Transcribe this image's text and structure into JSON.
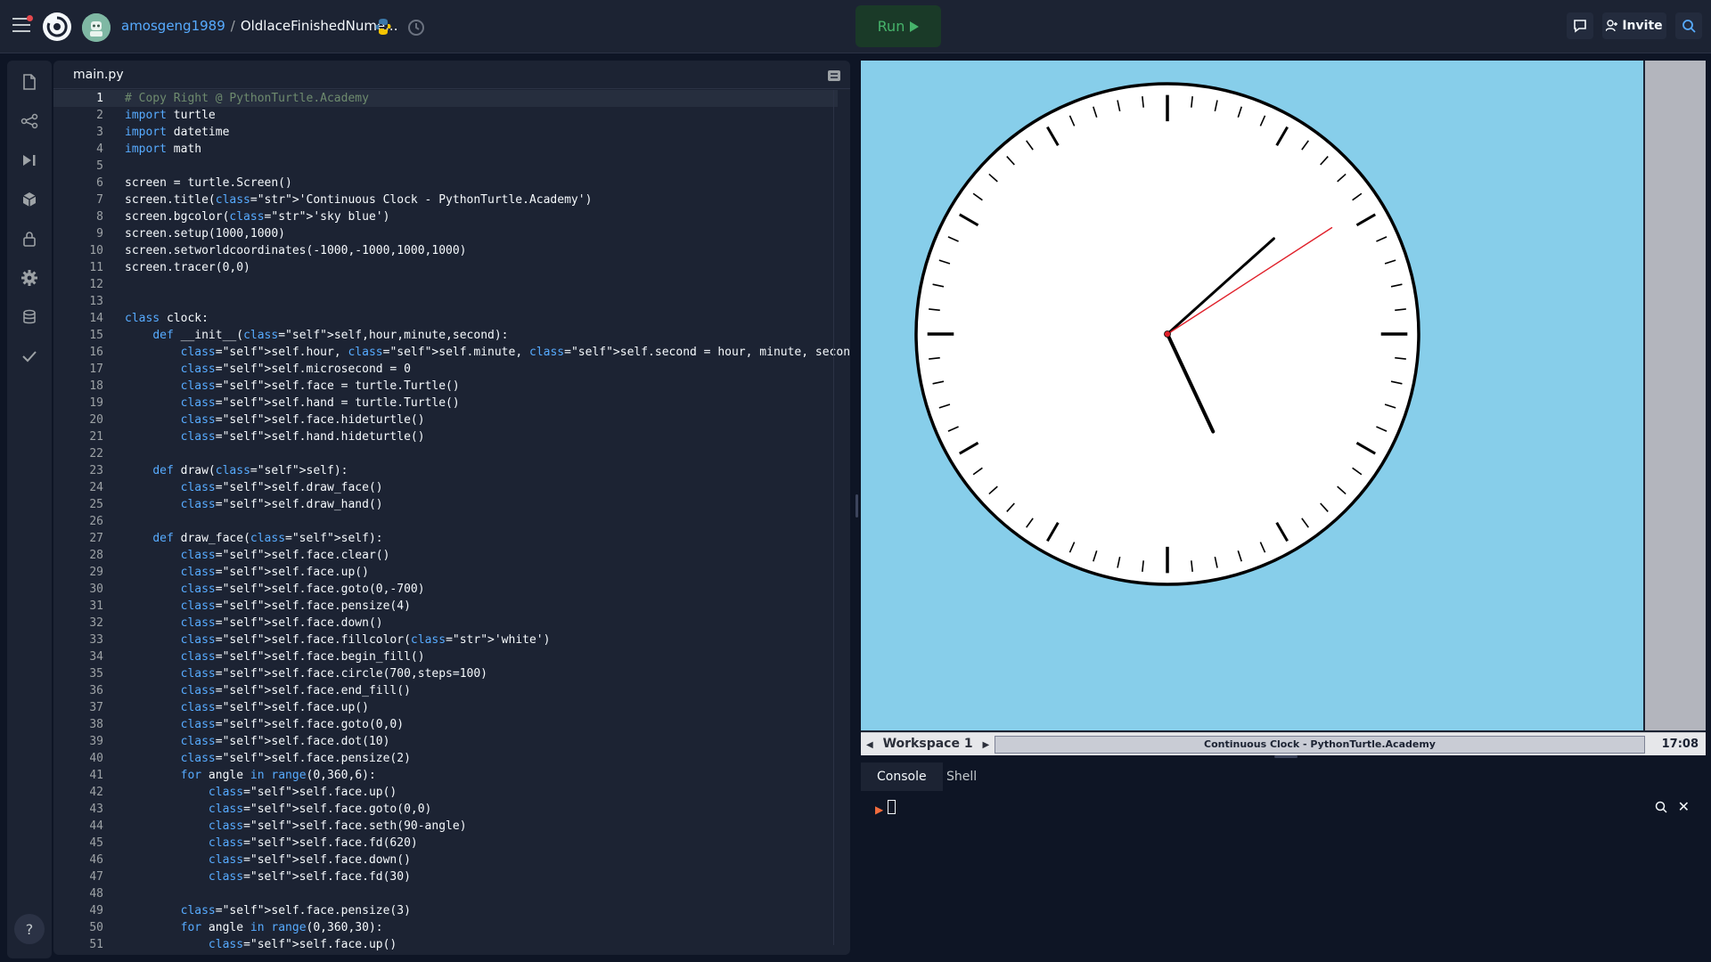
{
  "topbar": {
    "username": "amosgeng1989",
    "separator": "/",
    "repl_name": "OldlaceFinishedNume...",
    "run_label": "Run",
    "invite_label": "Invite"
  },
  "editor": {
    "tab_name": "main.py",
    "active_line": 1
  },
  "code_lines": [
    "# Copy Right @ PythonTurtle.Academy",
    "import turtle",
    "import datetime",
    "import math",
    "",
    "screen = turtle.Screen()",
    "screen.title('Continuous Clock - PythonTurtle.Academy')",
    "screen.bgcolor('sky blue')",
    "screen.setup(1000,1000)",
    "screen.setworldcoordinates(-1000,-1000,1000,1000)",
    "screen.tracer(0,0)",
    "",
    "",
    "class clock:",
    "    def __init__(self,hour,minute,second):",
    "        self.hour, self.minute, self.second = hour, minute, second",
    "        self.microsecond = 0",
    "        self.face = turtle.Turtle()",
    "        self.hand = turtle.Turtle()",
    "        self.face.hideturtle()",
    "        self.hand.hideturtle()",
    "",
    "    def draw(self):",
    "        self.draw_face()",
    "        self.draw_hand()",
    "",
    "    def draw_face(self):",
    "        self.face.clear()",
    "        self.face.up()",
    "        self.face.goto(0,-700)",
    "        self.face.pensize(4)",
    "        self.face.down()",
    "        self.face.fillcolor('white')",
    "        self.face.begin_fill()",
    "        self.face.circle(700,steps=100)",
    "        self.face.end_fill()",
    "        self.face.up()",
    "        self.face.goto(0,0)",
    "        self.face.dot(10)",
    "        self.face.pensize(2)",
    "        for angle in range(0,360,6):",
    "            self.face.up()",
    "            self.face.goto(0,0)",
    "            self.face.seth(90-angle)",
    "            self.face.fd(620)",
    "            self.face.down()",
    "            self.face.fd(30)",
    "",
    "        self.face.pensize(3)",
    "        for angle in range(0,360,30):",
    "            self.face.up()"
  ],
  "output": {
    "workspace_label": "Workspace 1",
    "window_title": "Continuous Clock - PythonTurtle.Academy",
    "clock_time": "17:08",
    "canvas_bg": "#87ceea",
    "clock_hands": {
      "hour_hand_angle_deg": 155,
      "minute_hand_angle_deg": 48,
      "second_hand_angle_deg": 57
    }
  },
  "console": {
    "tab_console": "Console",
    "tab_shell": "Shell"
  },
  "colors": {
    "app_bg": "#0e1525",
    "panel_bg": "#1c2333",
    "run_green": "#46b36a",
    "link_blue": "#57abff",
    "second_hand_red": "#e0202a"
  }
}
